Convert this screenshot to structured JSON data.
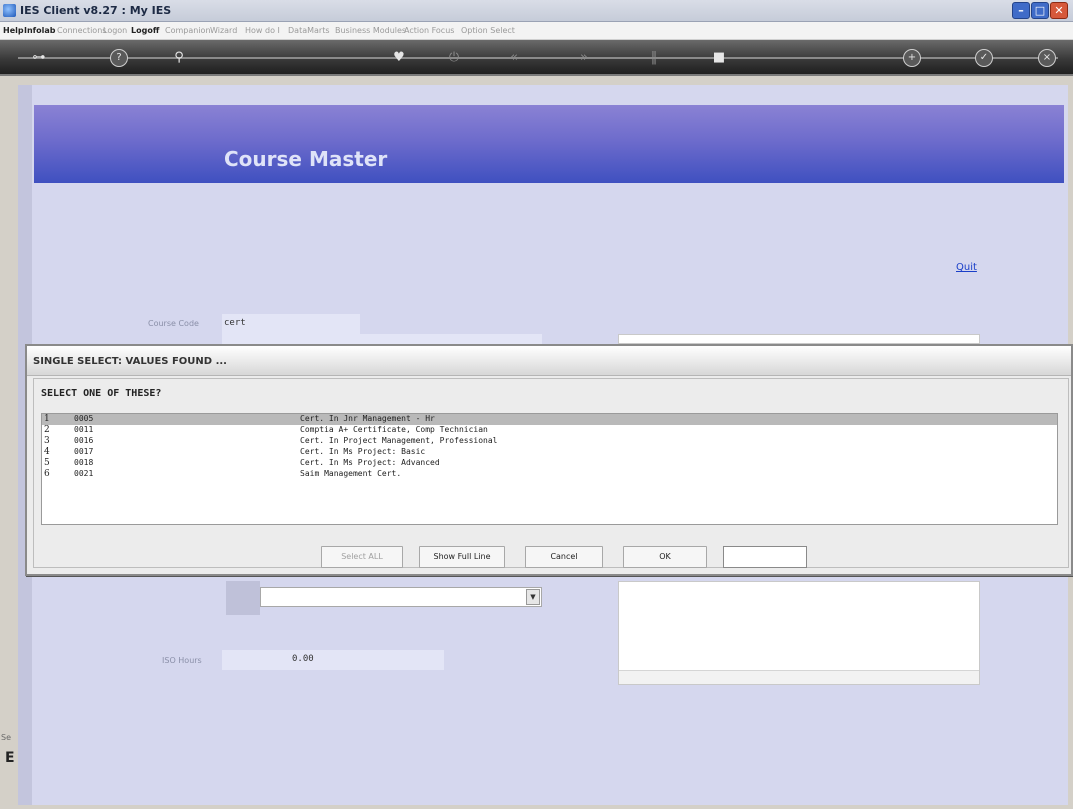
{
  "window": {
    "title": "IES Client v8.27 : My IES"
  },
  "menu": {
    "items": [
      "Help",
      "Infolab",
      "Connections",
      "Logon",
      "Logoff",
      "Companion",
      "Wizard",
      "How do I",
      "DataMarts",
      "Business Modules",
      "Action Focus",
      "Option Select"
    ]
  },
  "page": {
    "title": "Course Master",
    "quit_label": "Quit",
    "course_code_label": "Course Code",
    "course_code_value": "cert",
    "iso_hours_label": "ISO Hours",
    "iso_hours_value": "0.00",
    "side_text_1": "Se",
    "side_text_2": "E"
  },
  "dialog": {
    "title": "SINGLE SELECT: VALUES FOUND ...",
    "heading": "SELECT ONE OF THESE?",
    "rows": [
      {
        "idx": "1",
        "code": "0005",
        "desc": "Cert. In Jnr Management - Hr",
        "selected": true
      },
      {
        "idx": "2",
        "code": "0011",
        "desc": "Comptia A+ Certificate, Comp Technician",
        "selected": false
      },
      {
        "idx": "3",
        "code": "0016",
        "desc": "Cert. In Project Management, Professional",
        "selected": false
      },
      {
        "idx": "4",
        "code": "0017",
        "desc": "Cert. In Ms Project: Basic",
        "selected": false
      },
      {
        "idx": "5",
        "code": "0018",
        "desc": "Cert. In Ms Project: Advanced",
        "selected": false
      },
      {
        "idx": "6",
        "code": "0021",
        "desc": "Saim Management Cert.",
        "selected": false
      }
    ],
    "buttons": {
      "select_all": "Select ALL",
      "show_full_line": "Show Full Line",
      "cancel": "Cancel",
      "ok": "OK"
    }
  }
}
